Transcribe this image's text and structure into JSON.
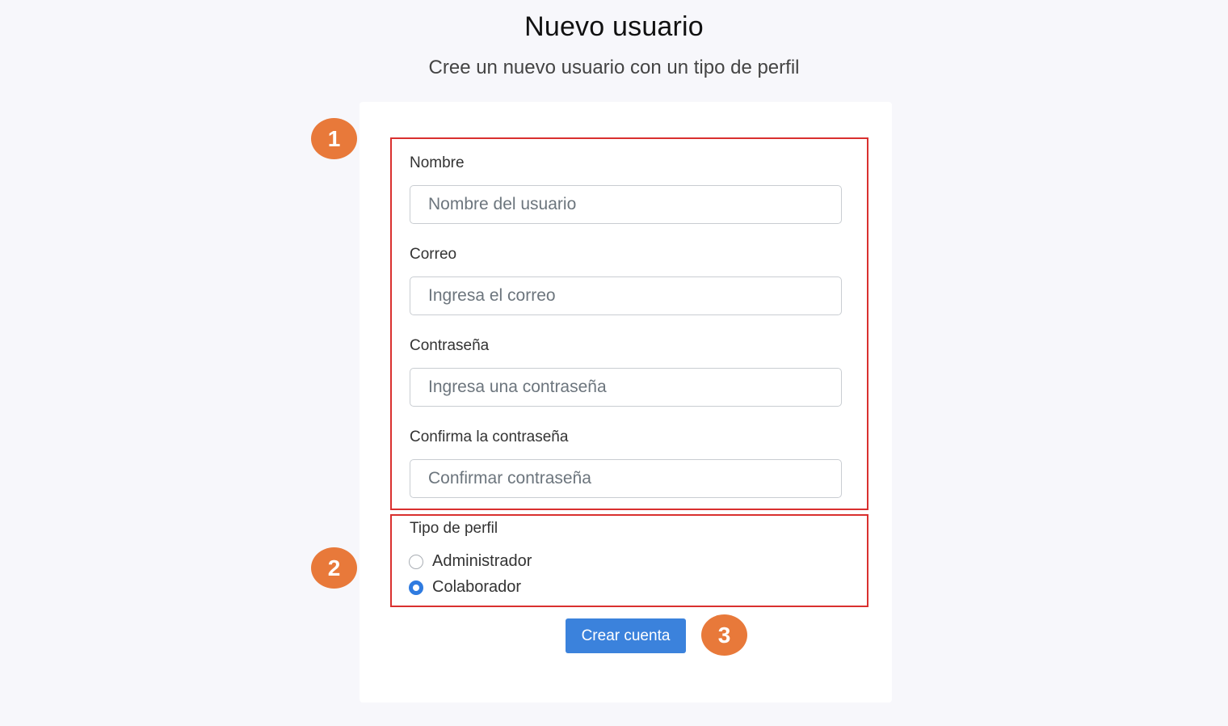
{
  "header": {
    "title": "Nuevo usuario",
    "subtitle": "Cree un nuevo usuario con un tipo de perfil"
  },
  "form": {
    "fields": [
      {
        "label": "Nombre",
        "placeholder": "Nombre del usuario",
        "value": ""
      },
      {
        "label": "Correo",
        "placeholder": "Ingresa el correo",
        "value": ""
      },
      {
        "label": "Contraseña",
        "placeholder": "Ingresa una contraseña",
        "value": ""
      },
      {
        "label": "Confirma la contraseña",
        "placeholder": "Confirmar contraseña",
        "value": ""
      }
    ],
    "profile_type": {
      "label": "Tipo de perfil",
      "options": [
        {
          "label": "Administrador",
          "checked": false
        },
        {
          "label": "Colaborador",
          "checked": true
        }
      ]
    },
    "submit_label": "Crear cuenta"
  },
  "annotations": {
    "badges": [
      "1",
      "2",
      "3"
    ],
    "badge_color": "#e8793a",
    "box_color": "#d9302f"
  },
  "colors": {
    "accent": "#3b82dc",
    "background": "#f7f7fb"
  }
}
